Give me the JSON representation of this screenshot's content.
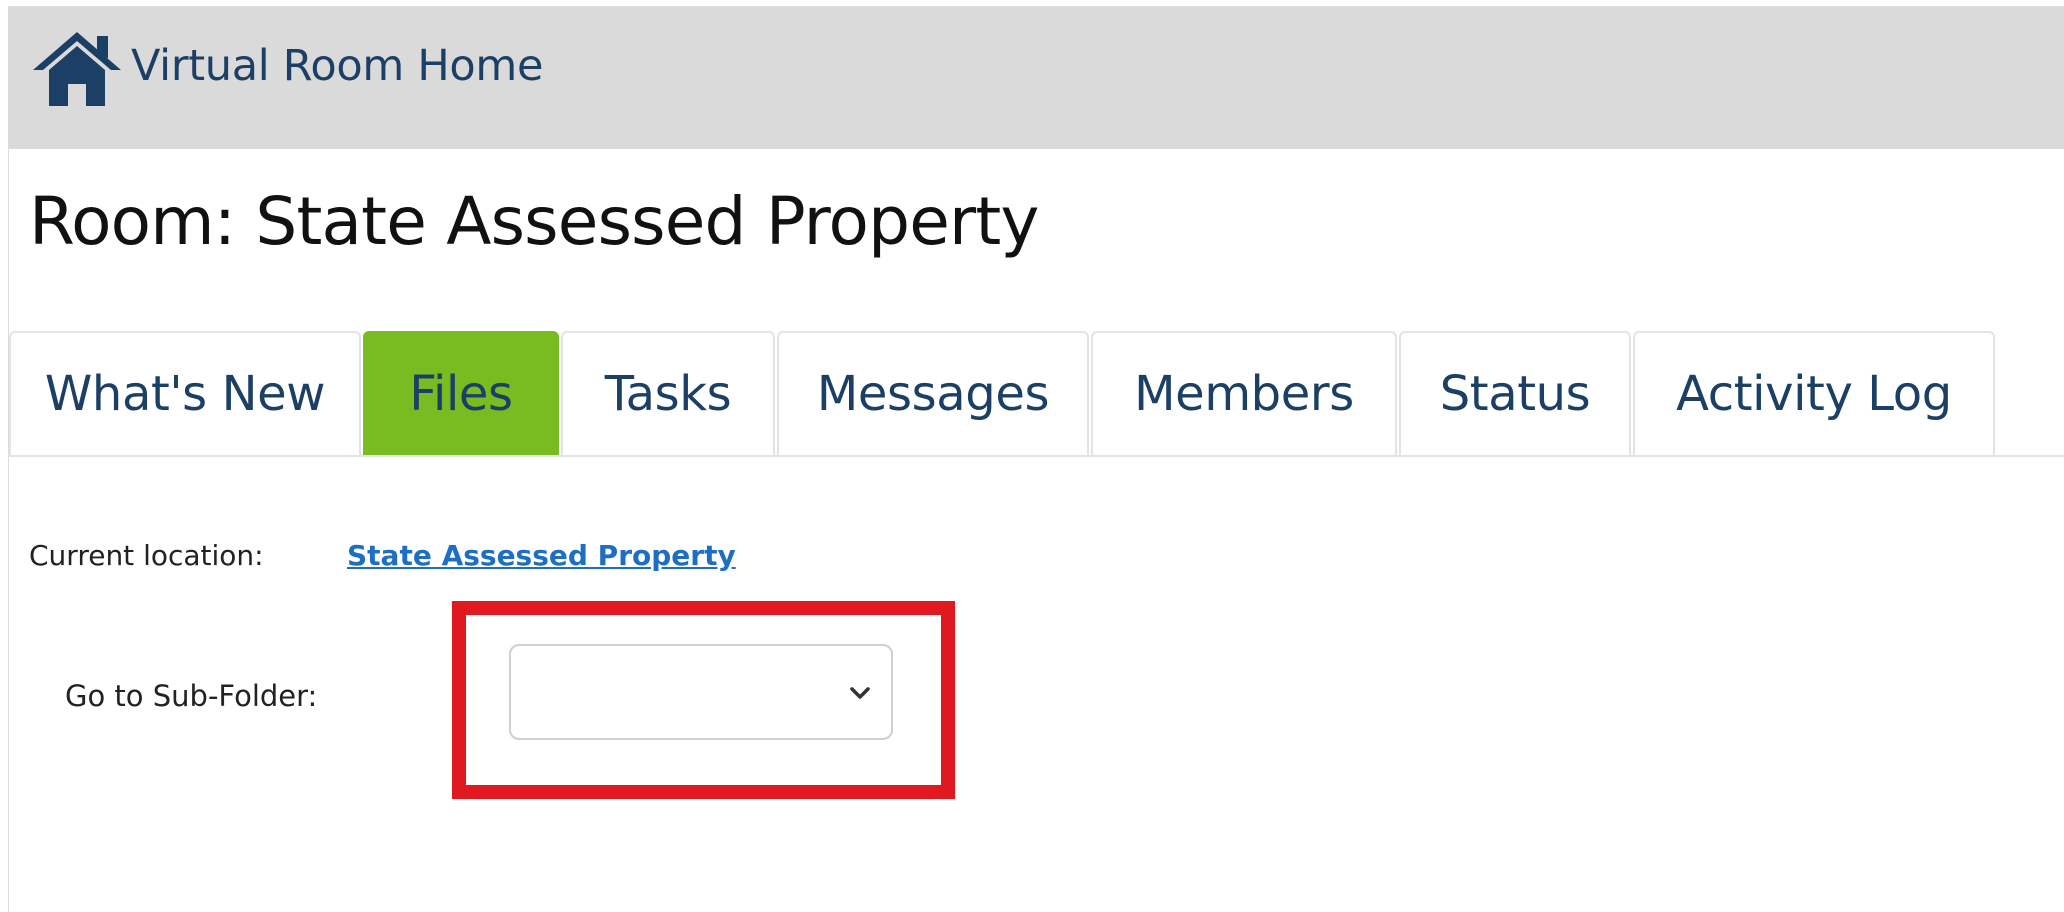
{
  "header": {
    "home_label": "Virtual Room Home",
    "icon": "house-icon"
  },
  "room": {
    "title": "Room: State Assessed Property"
  },
  "tabs": [
    {
      "label": "What's New",
      "active": false
    },
    {
      "label": "Files",
      "active": true
    },
    {
      "label": "Tasks",
      "active": false
    },
    {
      "label": "Messages",
      "active": false
    },
    {
      "label": "Members",
      "active": false
    },
    {
      "label": "Status",
      "active": false
    },
    {
      "label": "Activity Log",
      "active": false
    }
  ],
  "location": {
    "label": "Current location:",
    "link": "State Assessed Property"
  },
  "subfolder": {
    "label": "Go to Sub-Folder:",
    "selected": ""
  },
  "colors": {
    "header_bg": "#dadada",
    "brand_navy": "#1c3f66",
    "active_tab": "#78bc21",
    "link": "#1e6fc4",
    "highlight": "#e0181f"
  }
}
